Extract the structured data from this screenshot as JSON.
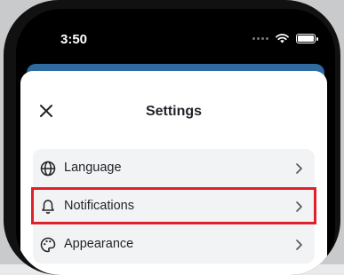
{
  "status_bar": {
    "time": "3:50"
  },
  "sheet": {
    "title": "Settings"
  },
  "settings": {
    "items": [
      {
        "label": "Language",
        "icon": "globe-icon"
      },
      {
        "label": "Notifications",
        "icon": "bell-icon"
      },
      {
        "label": "Appearance",
        "icon": "palette-icon"
      }
    ]
  },
  "colors": {
    "header_blue": "#2f6aa0",
    "highlight": "#e0202a",
    "list_bg": "#f2f3f5"
  }
}
